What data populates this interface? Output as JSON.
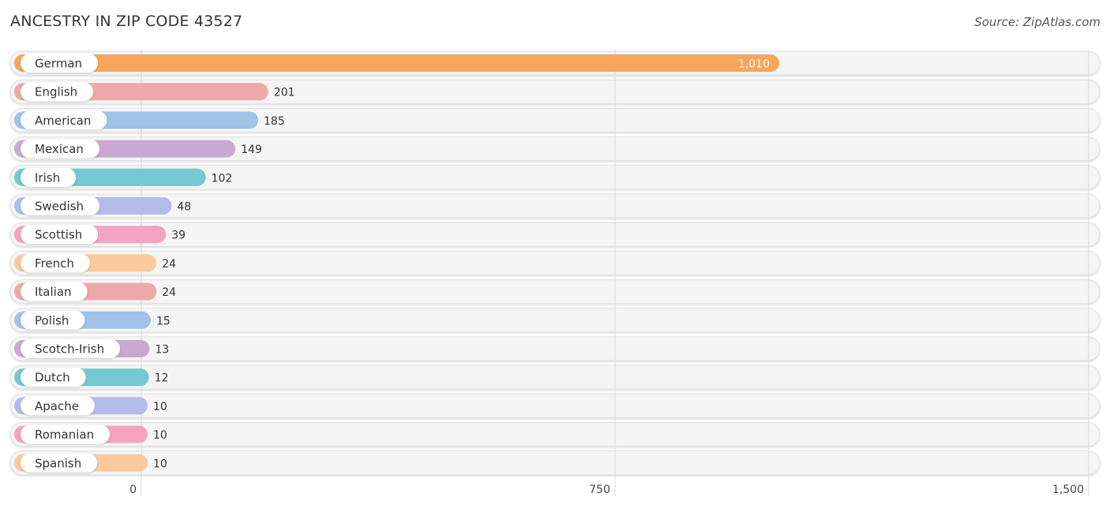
{
  "header": {
    "title": "ANCESTRY IN ZIP CODE 43527",
    "source": "Source: ZipAtlas.com"
  },
  "chart_data": {
    "type": "bar",
    "orientation": "horizontal",
    "title": "ANCESTRY IN ZIP CODE 43527",
    "xlabel": "",
    "ylabel": "",
    "xlim": [
      0,
      1500
    ],
    "grid": true,
    "x_ticks": [
      {
        "value": 0,
        "label": "0"
      },
      {
        "value": 750,
        "label": "750"
      },
      {
        "value": 1500,
        "label": "1,500"
      }
    ],
    "categories": [
      "German",
      "English",
      "American",
      "Mexican",
      "Irish",
      "Swedish",
      "Scottish",
      "French",
      "Italian",
      "Polish",
      "Scotch-Irish",
      "Dutch",
      "Apache",
      "Romanian",
      "Spanish"
    ],
    "values": [
      1010,
      201,
      185,
      149,
      102,
      48,
      39,
      24,
      24,
      15,
      13,
      12,
      10,
      10,
      10
    ],
    "value_labels": [
      "1,010",
      "201",
      "185",
      "149",
      "102",
      "48",
      "39",
      "24",
      "24",
      "15",
      "13",
      "12",
      "10",
      "10",
      "10"
    ],
    "colors": [
      "#f6a55a",
      "#eea8a8",
      "#9fc3e9",
      "#c9a9d1",
      "#74c8d0",
      "#b3bcea",
      "#f5a3c0",
      "#fac99c",
      "#eea8a8",
      "#9fc3e9",
      "#c9a9d1",
      "#74c8d0",
      "#b3bcea",
      "#f5a3c0",
      "#fac99c"
    ]
  }
}
